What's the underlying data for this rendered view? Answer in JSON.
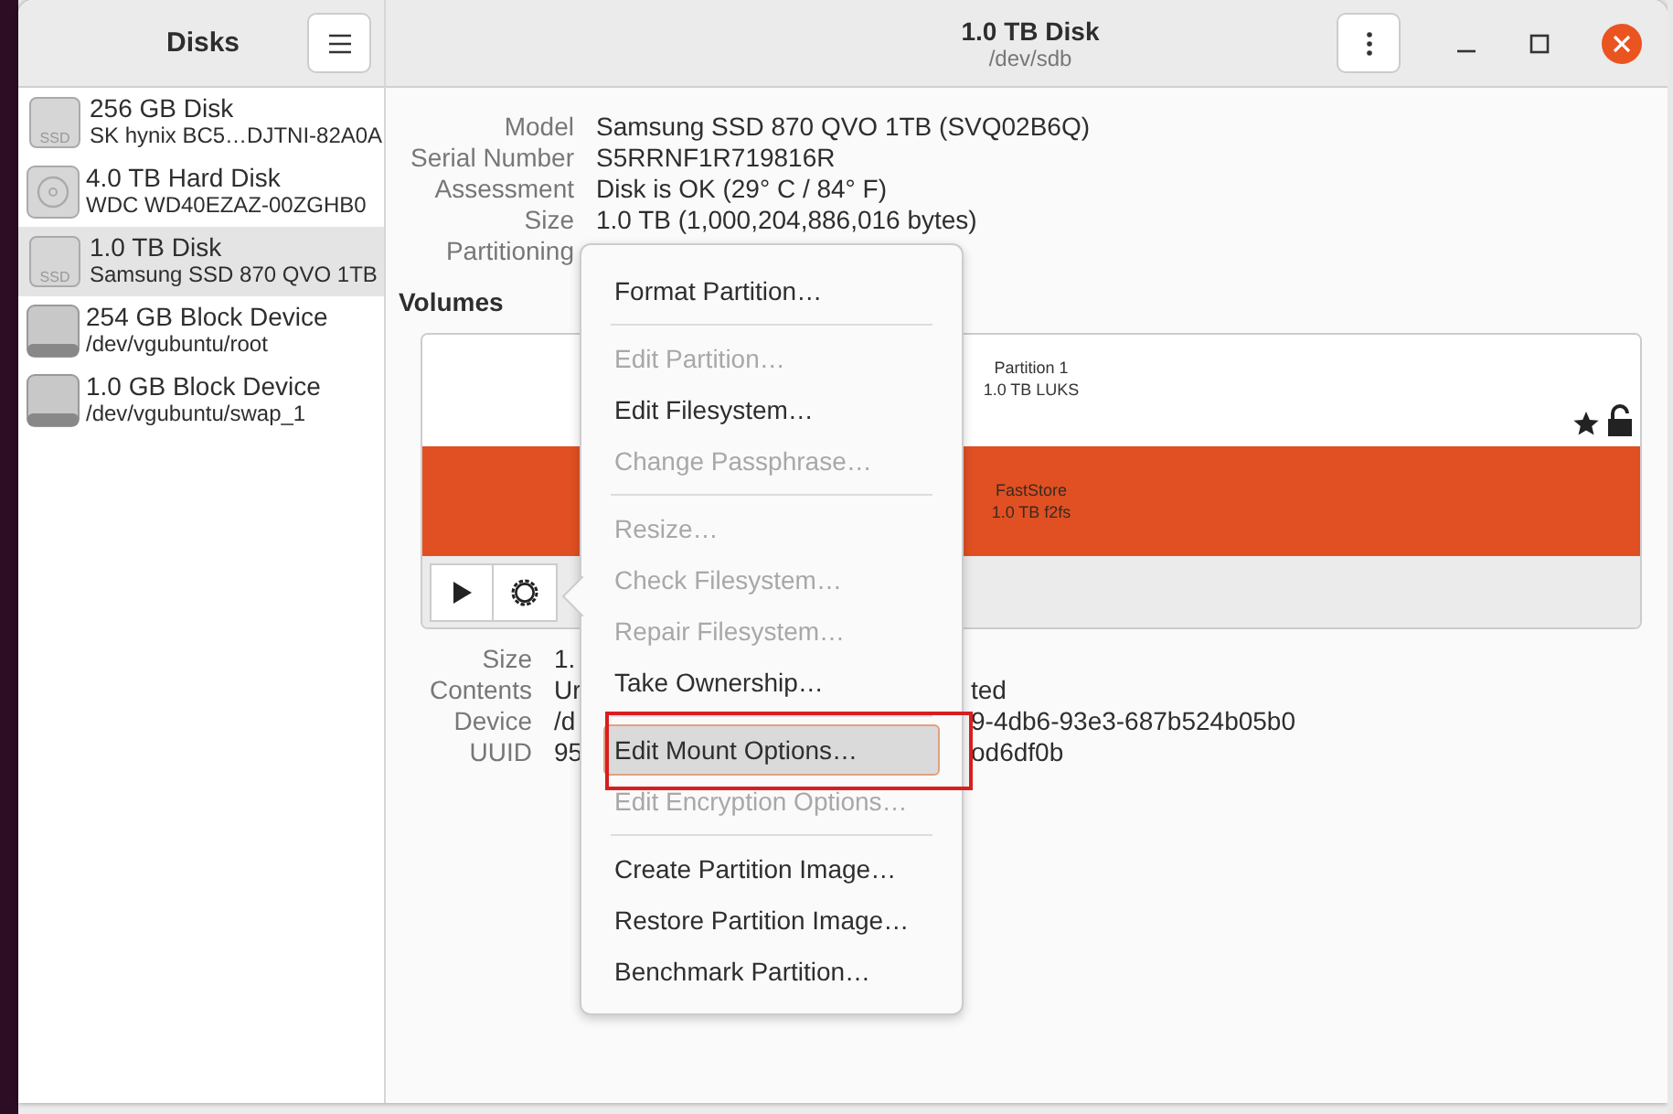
{
  "sidebar": {
    "title": "Disks",
    "items": [
      {
        "name": "256 GB Disk",
        "detail": "SK hynix BC5…DJTNI-82A0A",
        "kind": "ssd",
        "icon_label": "SSD",
        "selected": false
      },
      {
        "name": "4.0 TB Hard Disk",
        "detail": "WDC WD40EZAZ-00ZGHB0",
        "kind": "hdd",
        "selected": false
      },
      {
        "name": "1.0 TB Disk",
        "detail": "Samsung SSD 870 QVO 1TB",
        "kind": "ssd",
        "icon_label": "SSD",
        "selected": true
      },
      {
        "name": "254 GB Block Device",
        "detail": "/dev/vgubuntu/root",
        "kind": "block",
        "selected": false
      },
      {
        "name": "1.0 GB Block Device",
        "detail": "/dev/vgubuntu/swap_1",
        "kind": "block",
        "selected": false
      }
    ]
  },
  "window": {
    "title": "1.0 TB Disk",
    "subtitle": "/dev/sdb"
  },
  "disk_details": [
    {
      "label": "Model",
      "value": "Samsung SSD 870 QVO 1TB (SVQ02B6Q)"
    },
    {
      "label": "Serial Number",
      "value": "S5RRNF1R719816R"
    },
    {
      "label": "Assessment",
      "value": "Disk is OK (29° C / 84° F)"
    },
    {
      "label": "Size",
      "value": "1.0 TB (1,000,204,886,016 bytes)"
    },
    {
      "label": "Partitioning"
    }
  ],
  "volumes": {
    "title": "Volumes",
    "partition": {
      "name": "Partition 1",
      "detail": "1.0 TB LUKS",
      "starred": true,
      "locked": false
    },
    "filesystem": {
      "name": "FastStore",
      "detail": "1.0 TB f2fs",
      "selected": true
    }
  },
  "volume_details": [
    {
      "label": "Size",
      "value_start": "1."
    },
    {
      "label": "Contents",
      "value_start": "Ur",
      "value_end": "ted"
    },
    {
      "label": "Device",
      "value_start": "/d",
      "value_end": "9-4db6-93e3-687b524b05b0"
    },
    {
      "label": "UUID",
      "value_start": "95",
      "value_end": "od6df0b"
    }
  ],
  "menu": {
    "groups": [
      [
        {
          "label": "Format Partition…",
          "disabled": false,
          "selected": false,
          "annotated": false
        }
      ],
      [
        {
          "label": "Edit Partition…",
          "disabled": true,
          "selected": false,
          "annotated": false
        },
        {
          "label": "Edit Filesystem…",
          "disabled": false,
          "selected": false,
          "annotated": false
        },
        {
          "label": "Change Passphrase…",
          "disabled": true,
          "selected": false,
          "annotated": false
        }
      ],
      [
        {
          "label": "Resize…",
          "disabled": true,
          "selected": false,
          "annotated": false
        },
        {
          "label": "Check Filesystem…",
          "disabled": true,
          "selected": false,
          "annotated": false
        },
        {
          "label": "Repair Filesystem…",
          "disabled": true,
          "selected": false,
          "annotated": false
        },
        {
          "label": "Take Ownership…",
          "disabled": false,
          "selected": false,
          "annotated": false
        }
      ],
      [
        {
          "label": "Edit Mount Options…",
          "disabled": false,
          "selected": true,
          "annotated": true
        },
        {
          "label": "Edit Encryption Options…",
          "disabled": true,
          "selected": false,
          "annotated": false
        }
      ],
      [
        {
          "label": "Create Partition Image…",
          "disabled": false,
          "selected": false,
          "annotated": false
        },
        {
          "label": "Restore Partition Image…",
          "disabled": false,
          "selected": false,
          "annotated": false
        },
        {
          "label": "Benchmark Partition…",
          "disabled": false,
          "selected": false,
          "annotated": false
        }
      ]
    ]
  }
}
